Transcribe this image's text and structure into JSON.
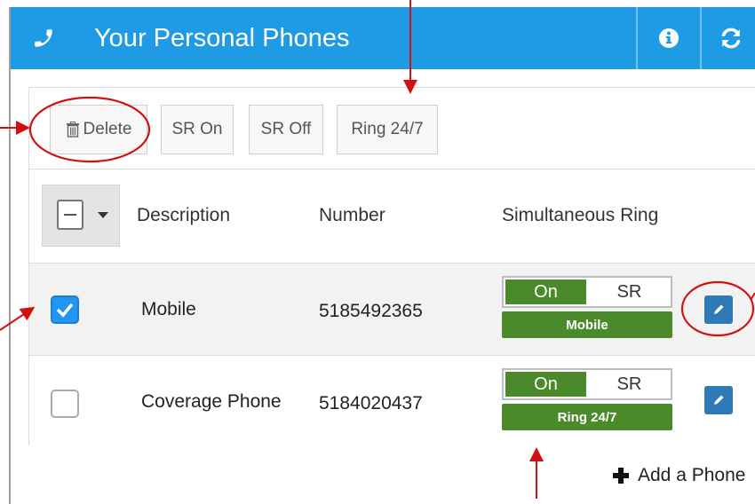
{
  "header": {
    "title": "Your Personal Phones",
    "bg_color": "#1e9be4",
    "phone_icon": "phone-icon",
    "info_icon": "info-icon",
    "refresh_icon": "refresh-icon"
  },
  "toolbar": {
    "delete_label": "Delete",
    "sr_on_label": "SR On",
    "sr_off_label": "SR Off",
    "ring_label": "Ring 24/7"
  },
  "table": {
    "columns": [
      "Description",
      "Number",
      "Simultaneous Ring"
    ],
    "rows": [
      {
        "checked": true,
        "description": "Mobile",
        "number": "5185492365",
        "toggle_on": "On",
        "toggle_sr": "SR",
        "tag": "Mobile"
      },
      {
        "checked": false,
        "description": "Coverage Phone",
        "number": "5184020437",
        "toggle_on": "On",
        "toggle_sr": "SR",
        "tag": "Ring 24/7"
      }
    ]
  },
  "footer": {
    "add_label": "Add a Phone"
  },
  "colors": {
    "accent": "#1e9be4",
    "green": "#4b8a2a",
    "edit_blue": "#2e7ab9",
    "annotation_red": "#d11111"
  }
}
